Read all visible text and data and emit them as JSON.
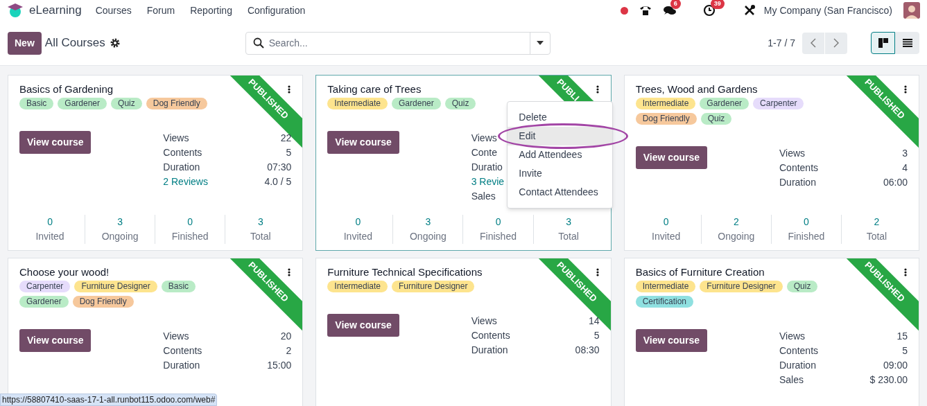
{
  "navbar": {
    "app_name": "eLearning",
    "menu": [
      "Courses",
      "Forum",
      "Reporting",
      "Configuration"
    ],
    "chat_badge": "6",
    "activity_badge": "39",
    "company": "My Company (San Francisco)"
  },
  "control_panel": {
    "new_button": "New",
    "title": "All Courses",
    "search": {
      "placeholder": "Search..."
    },
    "pager": "1-7 / 7",
    "views": [
      {
        "kind": "kanban",
        "selected": true
      },
      {
        "kind": "list",
        "selected": false
      }
    ]
  },
  "cards": [
    {
      "title": "Basics of Gardening",
      "ribbon": "PUBLISHED",
      "selected": false,
      "tags": [
        {
          "label": "Basic",
          "color": "#b9ebc6"
        },
        {
          "label": "Gardener",
          "color": "#b9ebc6"
        },
        {
          "label": "Quiz",
          "color": "#b9ebc6"
        },
        {
          "label": "Dog Friendly",
          "color": "#f6c89c"
        }
      ],
      "button": "View course",
      "stats": [
        {
          "label": "Views",
          "value": "22",
          "kind": "plain"
        },
        {
          "label": "Contents",
          "value": "5",
          "kind": "plain"
        },
        {
          "label": "Duration",
          "value": "07:30",
          "kind": "plain"
        },
        {
          "label": "2 Reviews",
          "value": "4.0 / 5",
          "kind": "link"
        }
      ],
      "counts": [
        {
          "value": "0",
          "label": "Invited"
        },
        {
          "value": "3",
          "label": "Ongoing"
        },
        {
          "value": "0",
          "label": "Finished"
        },
        {
          "value": "3",
          "label": "Total"
        }
      ]
    },
    {
      "title": "Taking care of Trees",
      "ribbon": "PUBLI",
      "selected": true,
      "tags": [
        {
          "label": "Intermediate",
          "color": "#fde48e"
        },
        {
          "label": "Gardener",
          "color": "#b9ebc6"
        },
        {
          "label": "Quiz",
          "color": "#b9ebc6"
        }
      ],
      "button": "View course",
      "stats": [
        {
          "label": "Views",
          "kind": "plain"
        },
        {
          "label": "Conte",
          "kind": "plain"
        },
        {
          "label": "Duratio",
          "kind": "plain"
        },
        {
          "label": "3 Revie",
          "kind": "link"
        },
        {
          "label": "Sales",
          "kind": "plain"
        }
      ],
      "counts": [
        {
          "value": "0",
          "label": "Invited"
        },
        {
          "value": "3",
          "label": "Ongoing"
        },
        {
          "value": "0",
          "label": "Finished"
        },
        {
          "value": "3",
          "label": "Total"
        }
      ],
      "menu": [
        {
          "label": "Delete",
          "selected": false,
          "circled": false
        },
        {
          "label": "Edit",
          "selected": true,
          "circled": true
        },
        {
          "label": "Add Attendees",
          "selected": false,
          "circled": false
        },
        {
          "label": "Invite",
          "selected": false,
          "circled": false
        },
        {
          "label": "Contact Attendees",
          "selected": false,
          "circled": false
        }
      ]
    },
    {
      "title": "Trees, Wood and Gardens",
      "ribbon": "PUBLISHED",
      "selected": false,
      "tags": [
        {
          "label": "Intermediate",
          "color": "#fde48e"
        },
        {
          "label": "Gardener",
          "color": "#b9ebc6"
        },
        {
          "label": "Carpenter",
          "color": "#e6dcfb"
        },
        {
          "label": "Dog Friendly",
          "color": "#f6c89c"
        },
        {
          "label": "Quiz",
          "color": "#b9ebc6"
        }
      ],
      "button": "View course",
      "stats": [
        {
          "label": "Views",
          "value": "3",
          "kind": "plain"
        },
        {
          "label": "Contents",
          "value": "4",
          "kind": "plain"
        },
        {
          "label": "Duration",
          "value": "06:00",
          "kind": "plain"
        }
      ],
      "counts": [
        {
          "value": "0",
          "label": "Invited"
        },
        {
          "value": "2",
          "label": "Ongoing"
        },
        {
          "value": "0",
          "label": "Finished"
        },
        {
          "value": "2",
          "label": "Total"
        }
      ]
    },
    {
      "title": "Choose your wood!",
      "ribbon": "PUBLISHED",
      "selected": false,
      "tags": [
        {
          "label": "Carpenter",
          "color": "#e6dcfb"
        },
        {
          "label": "Furniture Designer",
          "color": "#fde48e"
        },
        {
          "label": "Basic",
          "color": "#b9ebc6"
        },
        {
          "label": "Gardener",
          "color": "#b9ebc6"
        },
        {
          "label": "Dog Friendly",
          "color": "#f6c89c"
        }
      ],
      "button": "View course",
      "stats": [
        {
          "label": "Views",
          "value": "20",
          "kind": "plain"
        },
        {
          "label": "Contents",
          "value": "2",
          "kind": "plain"
        },
        {
          "label": "Duration",
          "value": "15:00",
          "kind": "plain"
        }
      ]
    },
    {
      "title": "Furniture Technical Specifications",
      "ribbon": "PUBLISHED",
      "selected": false,
      "tags": [
        {
          "label": "Intermediate",
          "color": "#fde48e"
        },
        {
          "label": "Furniture Designer",
          "color": "#fde48e"
        }
      ],
      "button": "View course",
      "stats": [
        {
          "label": "Views",
          "value": "14",
          "kind": "plain"
        },
        {
          "label": "Contents",
          "value": "5",
          "kind": "plain"
        },
        {
          "label": "Duration",
          "value": "08:30",
          "kind": "plain"
        }
      ]
    },
    {
      "title": "Basics of Furniture Creation",
      "ribbon": "PUBLISHED",
      "selected": false,
      "tags": [
        {
          "label": "Intermediate",
          "color": "#fde48e"
        },
        {
          "label": "Furniture Designer",
          "color": "#fde48e"
        },
        {
          "label": "Quiz",
          "color": "#b9ebc6"
        },
        {
          "label": "Certification",
          "color": "#8fe0e0"
        }
      ],
      "button": "View course",
      "stats": [
        {
          "label": "Views",
          "value": "15",
          "kind": "plain"
        },
        {
          "label": "Contents",
          "value": "5",
          "kind": "plain"
        },
        {
          "label": "Duration",
          "value": "09:00",
          "kind": "plain"
        },
        {
          "label": "Sales",
          "value": "$ 230.00",
          "kind": "plain"
        }
      ]
    }
  ],
  "status_url": "https://58807410-saas-17-1-all.runbot115.odoo.com/web#"
}
